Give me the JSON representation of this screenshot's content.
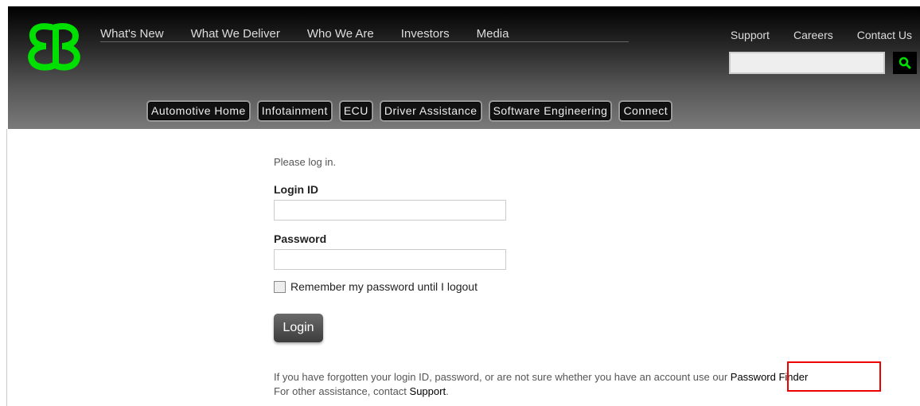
{
  "nav_main": [
    "What's New",
    "What We Deliver",
    "Who We Are",
    "Investors",
    "Media"
  ],
  "nav_util": [
    "Support",
    "Careers",
    "Contact Us"
  ],
  "search": {
    "value": ""
  },
  "subnav": [
    "Automotive Home",
    "Infotainment",
    "ECU",
    "Driver Assistance",
    "Software Engineering",
    "Connect"
  ],
  "form": {
    "intro": "Please log in.",
    "login_id_label": "Login ID",
    "password_label": "Password",
    "remember_label": "Remember my password until I logout",
    "login_button": "Login",
    "help_text": "If you have forgotten your login ID, password, or are not sure whether you have an account use our ",
    "password_finder": "Password Finder",
    "assist_prefix": "For other assistance, contact ",
    "assist_link": "Support",
    "assist_suffix": "."
  },
  "colors": {
    "brand_green": "#00e000",
    "highlight": "#e00000"
  }
}
